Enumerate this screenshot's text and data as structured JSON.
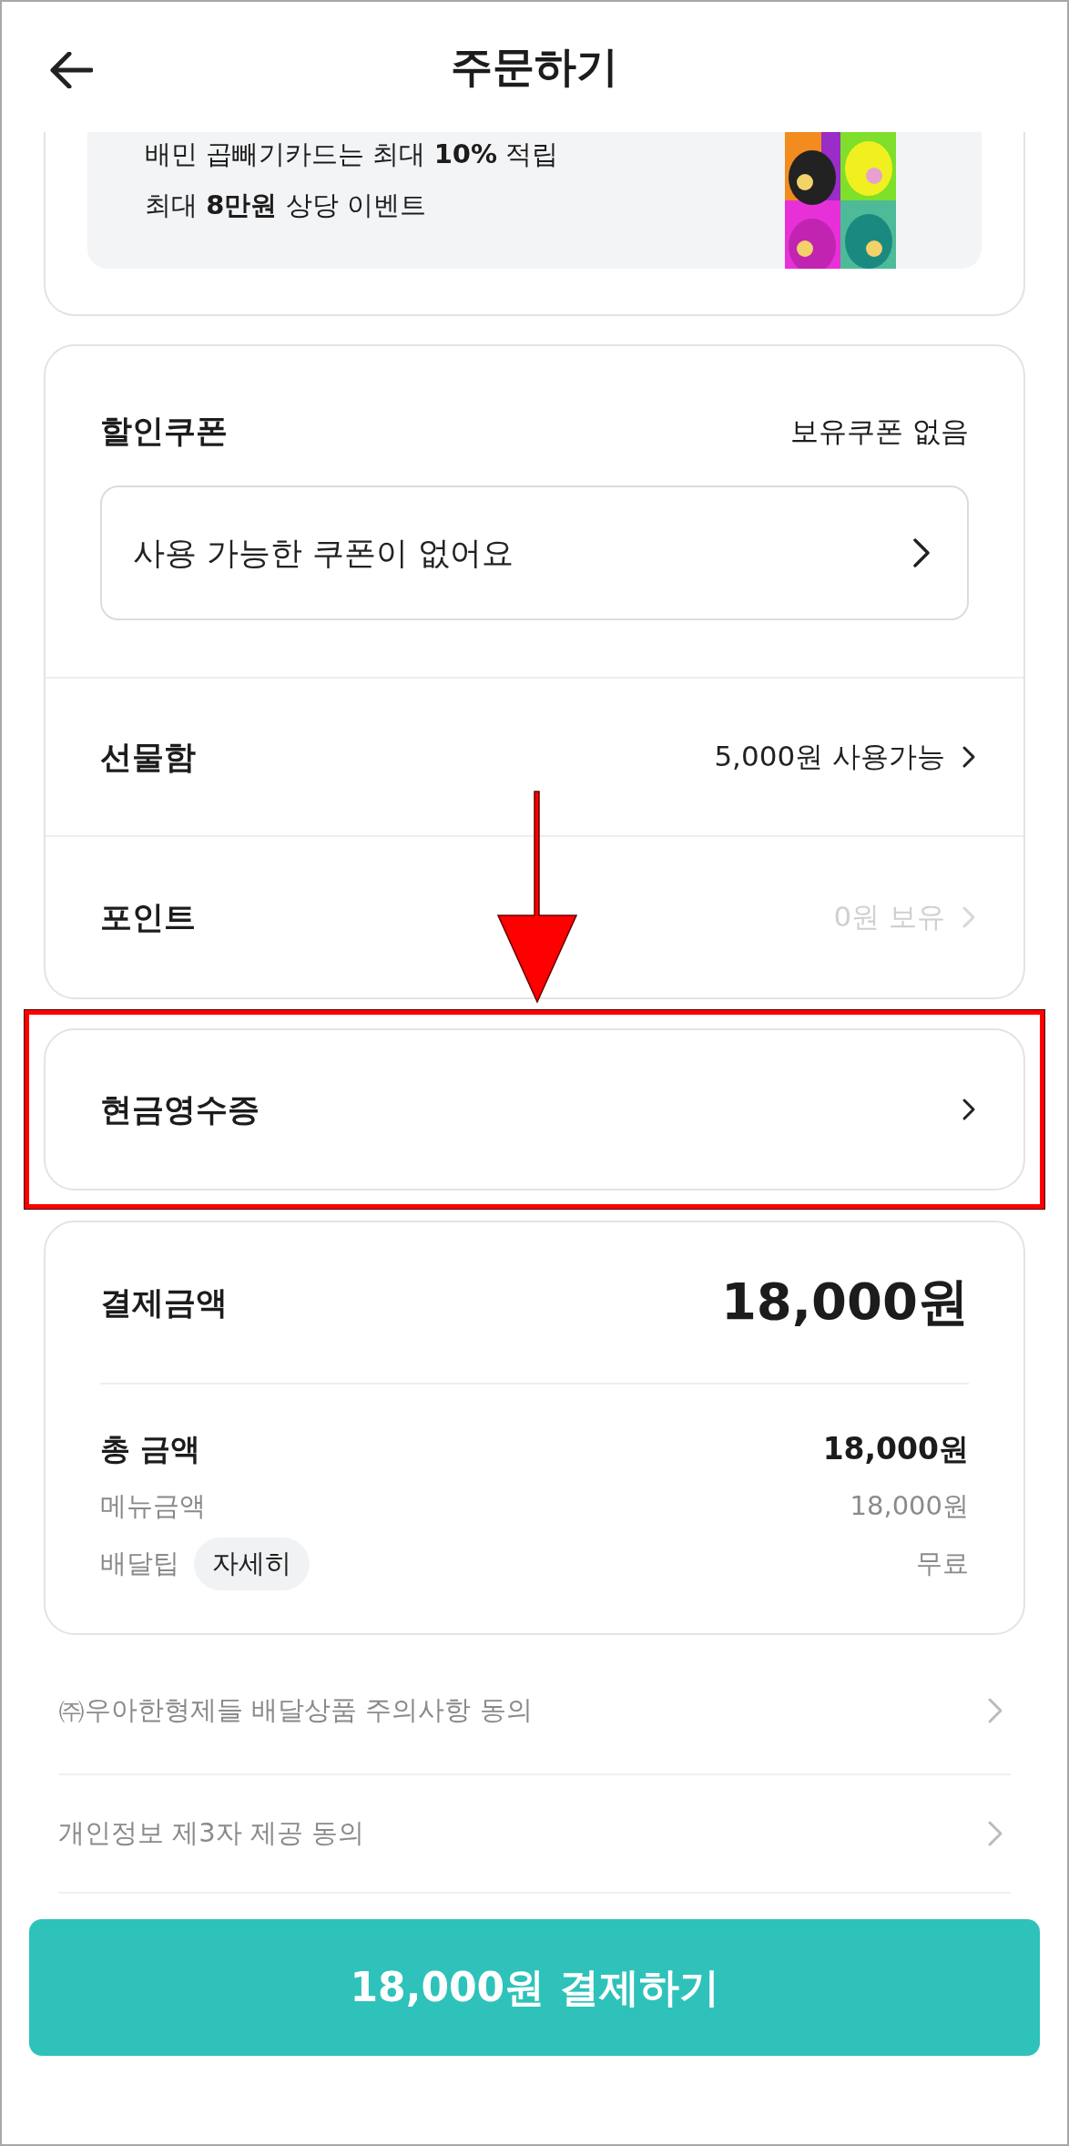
{
  "header": {
    "title": "주문하기"
  },
  "promo": {
    "lines": [
      "배민 곱빼기카드는 최대 **10%** 적립",
      "최대 **8만원** 상당 이벤트"
    ]
  },
  "discounts": {
    "coupon": {
      "label": "할인쿠폰",
      "status": "보유쿠폰 없음",
      "field_text": "사용 가능한 쿠폰이 없어요"
    },
    "rows": [
      {
        "label": "선물함",
        "value": "5,000원 사용가능",
        "disabled": false
      },
      {
        "label": "포인트",
        "value": "0원 보유",
        "disabled": true
      }
    ]
  },
  "cash_receipt": {
    "label": "현금영수증",
    "highlighted": true
  },
  "payment": {
    "title": "결제금액",
    "total": "18,000원",
    "summary": {
      "label": "총 금액",
      "value": "18,000원"
    },
    "details": [
      {
        "label": "메뉴금액",
        "value": "18,000원"
      },
      {
        "label": "배달팁",
        "badge": "자세히",
        "value": "무료"
      }
    ]
  },
  "agreements": [
    "㈜우아한형제들 배달상품 주의사항 동의",
    "개인정보 제3자 제공 동의"
  ],
  "pay_button": {
    "label": "18,000원 결제하기"
  }
}
